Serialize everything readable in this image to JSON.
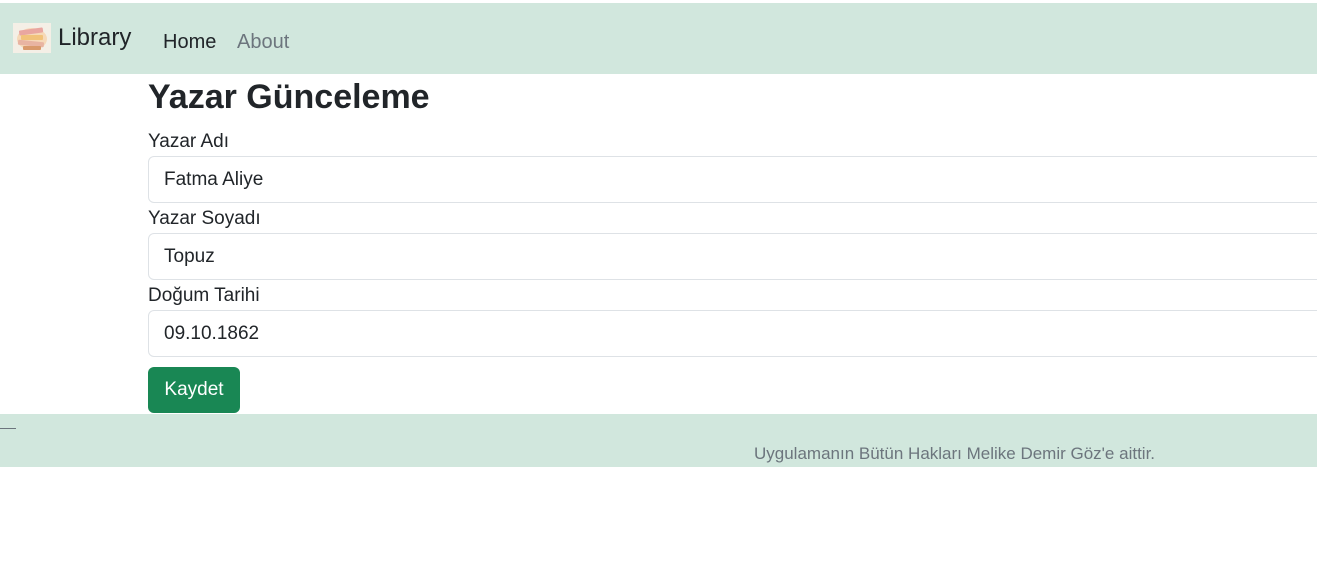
{
  "navbar": {
    "brand_label": "Library",
    "logo_icon": "book-stack-icon",
    "links": [
      {
        "label": "Home",
        "active": true
      },
      {
        "label": "About",
        "active": false
      }
    ]
  },
  "form": {
    "title": "Yazar Günceleme",
    "fields": [
      {
        "label": "Yazar Adı",
        "value": "Fatma Aliye"
      },
      {
        "label": "Yazar Soyadı",
        "value": "Topuz"
      },
      {
        "label": "Doğum Tarihi",
        "value": "09.10.1862"
      }
    ],
    "submit_label": "Kaydet"
  },
  "footer": {
    "text": "Uygulamanın Bütün Hakları Melike Demir Göz'e aittir."
  },
  "colors": {
    "navbar_bg": "#d1e7dd",
    "footer_bg": "#d1e7dd",
    "primary_button": "#198754",
    "muted_text": "#6c757d"
  }
}
